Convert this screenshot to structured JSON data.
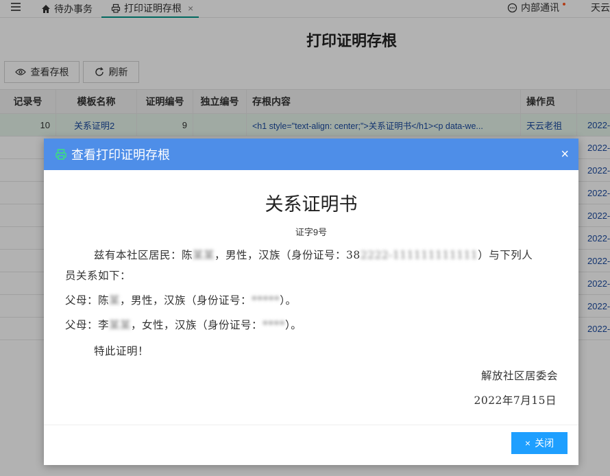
{
  "tabs": {
    "home_label": "待办事务",
    "active_label": "打印证明存根",
    "close_glyph": "×",
    "notify_label": "内部通讯",
    "user_label": "天云"
  },
  "page": {
    "title": "打印证明存根"
  },
  "toolbar": {
    "view_label": "查看存根",
    "refresh_label": "刷新"
  },
  "table": {
    "headers": [
      "记录号",
      "模板名称",
      "证明编号",
      "独立编号",
      "存根内容",
      "操作员"
    ],
    "row": {
      "record_no": "10",
      "template": "关系证明2",
      "cert_no": "9",
      "indep_no": "",
      "content": "<h1 style=\"text-align: center;\">关系证明书</h1><p data-we...",
      "operator": "天云老祖",
      "time": "2022-"
    },
    "other_time_prefix": [
      "2022-",
      "2022-",
      "2022-",
      "2022-",
      "2022-",
      "2022-",
      "2022-",
      "2022-",
      "2022-"
    ]
  },
  "modal": {
    "title": "查看打印证明存根",
    "close_glyph": "×",
    "doc_title": "关系证明书",
    "doc_no": "证字9号",
    "p1_prefix": "兹有本社区居民：陈",
    "p1_name_blur": "某某",
    "p1_mid": "，男性，汉族（身份证号：38",
    "p1_id_blur": "2222-111111111111",
    "p1_suffix": "）与下列人",
    "p1_line2": "员关系如下：",
    "father_prefix": "父母：陈",
    "father_blur": "某",
    "father_mid": "，男性，汉族（身份证号：",
    "father_id_blur": "*****",
    "father_suffix": "）。",
    "mother_prefix": "父母：李",
    "mother_blur": "某某",
    "mother_mid": "，女性，汉族（身份证号：",
    "mother_id_blur": "****",
    "mother_suffix": "）。",
    "special": "特此证明！",
    "signer": "解放社区居委会",
    "date": "2022年7月15日",
    "close_button": "关闭",
    "close_button_glyph": "×"
  },
  "colors": {
    "modal_header": "#4e8ee8",
    "primary_button": "#1e9fff",
    "tab_underline": "#009688"
  }
}
